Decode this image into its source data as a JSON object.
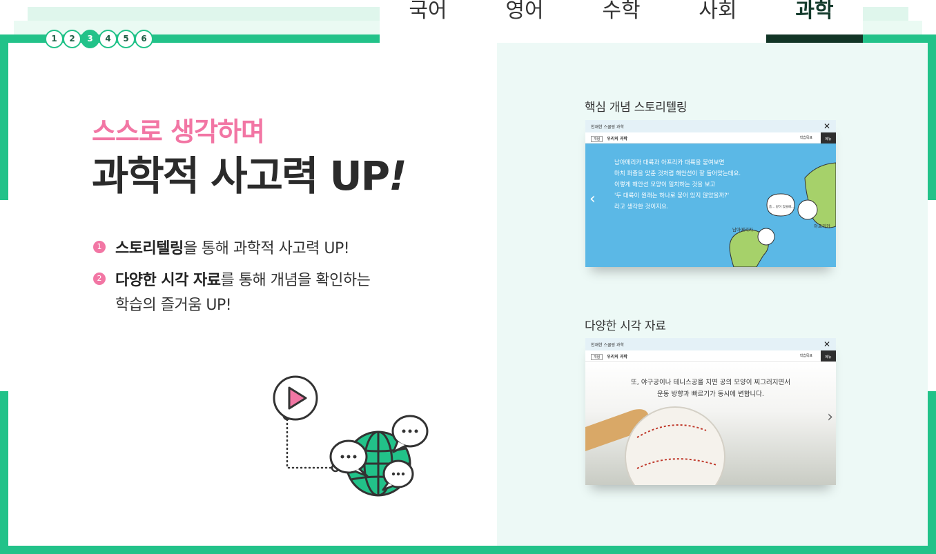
{
  "tabs": [
    {
      "label": "국어",
      "active": false
    },
    {
      "label": "영어",
      "active": false
    },
    {
      "label": "수학",
      "active": false
    },
    {
      "label": "사회",
      "active": false
    },
    {
      "label": "과학",
      "active": true
    }
  ],
  "steps": [
    "1",
    "2",
    "3",
    "4",
    "5",
    "6"
  ],
  "active_step": "3",
  "hero": {
    "subtitle": "스스로 생각하며",
    "headline": "과학적 사고력 UP",
    "headline_mark": "!"
  },
  "bullets": [
    {
      "num": "1",
      "bold": "스토리텔링",
      "rest": "을 통해 과학적 사고력 UP!"
    },
    {
      "num": "2",
      "bold": "다양한 시각 자료",
      "rest": "를 통해 개념을 확인하는",
      "line2": "학습의 즐거움 UP!"
    }
  ],
  "screens": [
    {
      "title": "핵심 개념 스토리텔링",
      "bar_title": "천재한 스쿨링 과학",
      "tag": "개념",
      "sub_title": "우리의 과학",
      "goal": "학습목표",
      "menu": "메뉴",
      "close": "✕",
      "body_lines": [
        "남아메리카 대륙과 아프리카 대륙을 붙여보면",
        "마치 퍼즐을 맞춘 것처럼 해안선이 잘 들어맞는데요.",
        "이렇게 해안선 모양이 일치하는 것을 보고",
        "'두 대륙이 원래는 하나로 붙어 있지 않았을까?'",
        "라고 생각한 것이지요."
      ],
      "map_labels": {
        "south_america": "남아메리카",
        "africa": "아프리카",
        "bubble": "흠... 같이 있을때..."
      }
    },
    {
      "title": "다양한 시각 자료",
      "bar_title": "천재한 스쿨링 과학",
      "tag": "개념",
      "sub_title": "우리의 과학",
      "goal": "학습목표",
      "menu": "메뉴",
      "close": "✕",
      "line1": "또, 야구공이나 테니스공을 치면 공의 모양이 찌그러지면서",
      "line2": "운동 방향과 빠르기가 동시에 변합니다."
    }
  ],
  "colors": {
    "accent": "#22c289",
    "pink": "#f276a4",
    "tab_active": "#123526",
    "panel_bg": "#edf9f6"
  }
}
